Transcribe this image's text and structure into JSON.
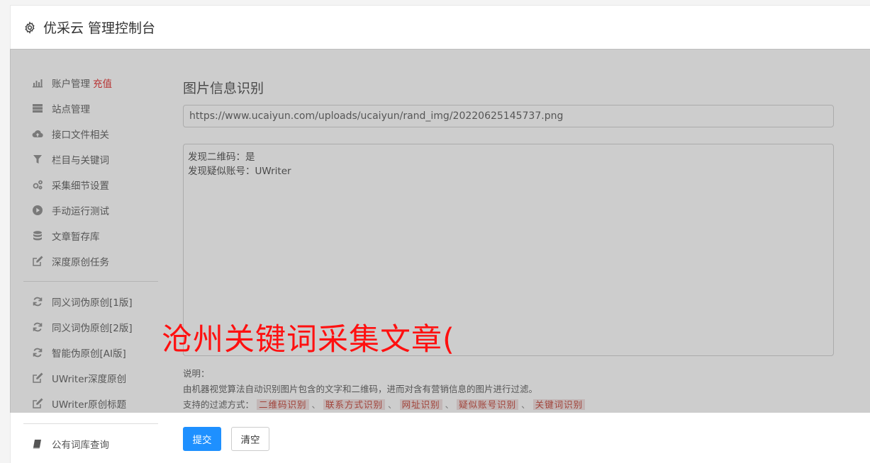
{
  "header": {
    "title": "优采云 管理控制台",
    "icon": "gear-icon"
  },
  "sidebar": {
    "group1": [
      {
        "label": "账户管理",
        "badge": "充值",
        "icon": "bar-chart-icon"
      },
      {
        "label": "站点管理",
        "icon": "server-icon"
      },
      {
        "label": "接口文件相关",
        "icon": "cloud-upload-icon"
      },
      {
        "label": "栏目与关键词",
        "icon": "filter-icon"
      },
      {
        "label": "采集细节设置",
        "icon": "gears-icon"
      },
      {
        "label": "手动运行测试",
        "icon": "play-icon"
      },
      {
        "label": "文章暂存库",
        "icon": "database-icon"
      },
      {
        "label": "深度原创任务",
        "icon": "edit-icon"
      }
    ],
    "group2": [
      {
        "label": "同义词伪原创[1版]",
        "icon": "refresh-icon"
      },
      {
        "label": "同义词伪原创[2版]",
        "icon": "refresh-icon"
      },
      {
        "label": "智能伪原创[AI版]",
        "icon": "refresh-icon"
      },
      {
        "label": "UWriter深度原创",
        "icon": "edit-icon"
      },
      {
        "label": "UWriter原创标题",
        "icon": "edit-icon"
      }
    ],
    "group3": [
      {
        "label": "公有词库查询",
        "icon": "book-icon"
      }
    ]
  },
  "main": {
    "section_title": "图片信息识别",
    "url_value": "https://www.ucaiyun.com/uploads/ucaiyun/rand_img/20220625145737.png",
    "result_text": "发现二维码：是\n发现疑似账号：UWriter",
    "desc_heading": "说明：",
    "desc_line": "由机器视觉算法自动识别图片包含的文字和二维码，进而对含有营销信息的图片进行过滤。",
    "filter_label": "支持的过滤方式：",
    "filter_tags": [
      "二维码识别",
      "联系方式识别",
      "网址识别",
      "疑似账号识别",
      "关键词识别"
    ],
    "filter_sep": "、",
    "submit_label": "提交",
    "clear_label": "清空"
  },
  "watermark": "沧州关键词采集文章(",
  "colors": {
    "primary": "#1e90ff",
    "badge": "#e02020",
    "watermark": "#ff1010",
    "tag": "#c0392b"
  }
}
